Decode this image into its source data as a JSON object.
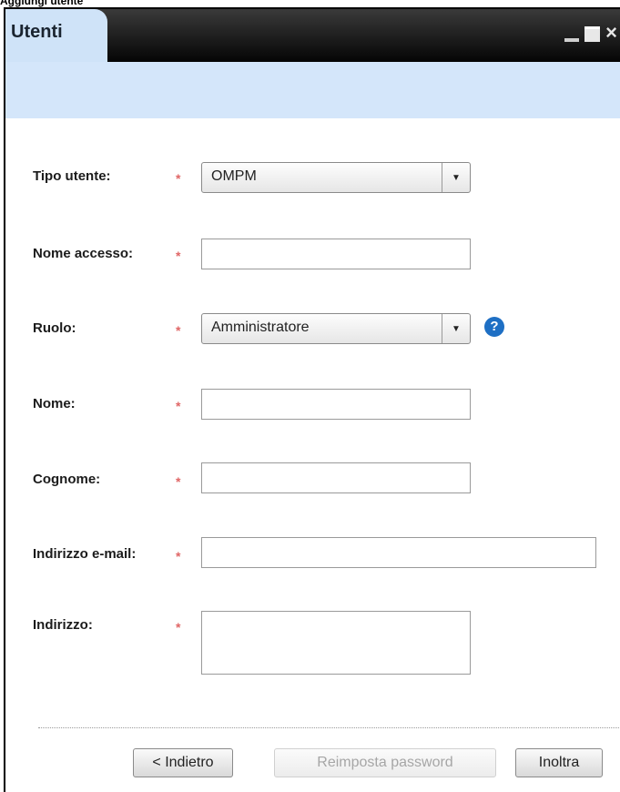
{
  "caption": "Aggiungi utente",
  "window": {
    "title": "Utenti"
  },
  "form": {
    "tipo_utente": {
      "label": "Tipo utente:",
      "value": "OMPM"
    },
    "nome_accesso": {
      "label": "Nome accesso:",
      "value": ""
    },
    "ruolo": {
      "label": "Ruolo:",
      "value": "Amministratore"
    },
    "nome": {
      "label": "Nome:",
      "value": ""
    },
    "cognome": {
      "label": "Cognome:",
      "value": ""
    },
    "email": {
      "label": "Indirizzo e-mail:",
      "value": ""
    },
    "indirizzo": {
      "label": "Indirizzo:",
      "value": ""
    },
    "required_marker": "*"
  },
  "buttons": {
    "back": "< Indietro",
    "reset_password": "Reimposta password",
    "submit": "Inoltra"
  },
  "icons": {
    "help": "?",
    "minimize": "minimize-icon",
    "maximize": "maximize-icon",
    "close": "×"
  },
  "colors": {
    "required": "#e06666",
    "header_blue": "#d4e6fa",
    "help_icon": "#1e6fc4"
  }
}
